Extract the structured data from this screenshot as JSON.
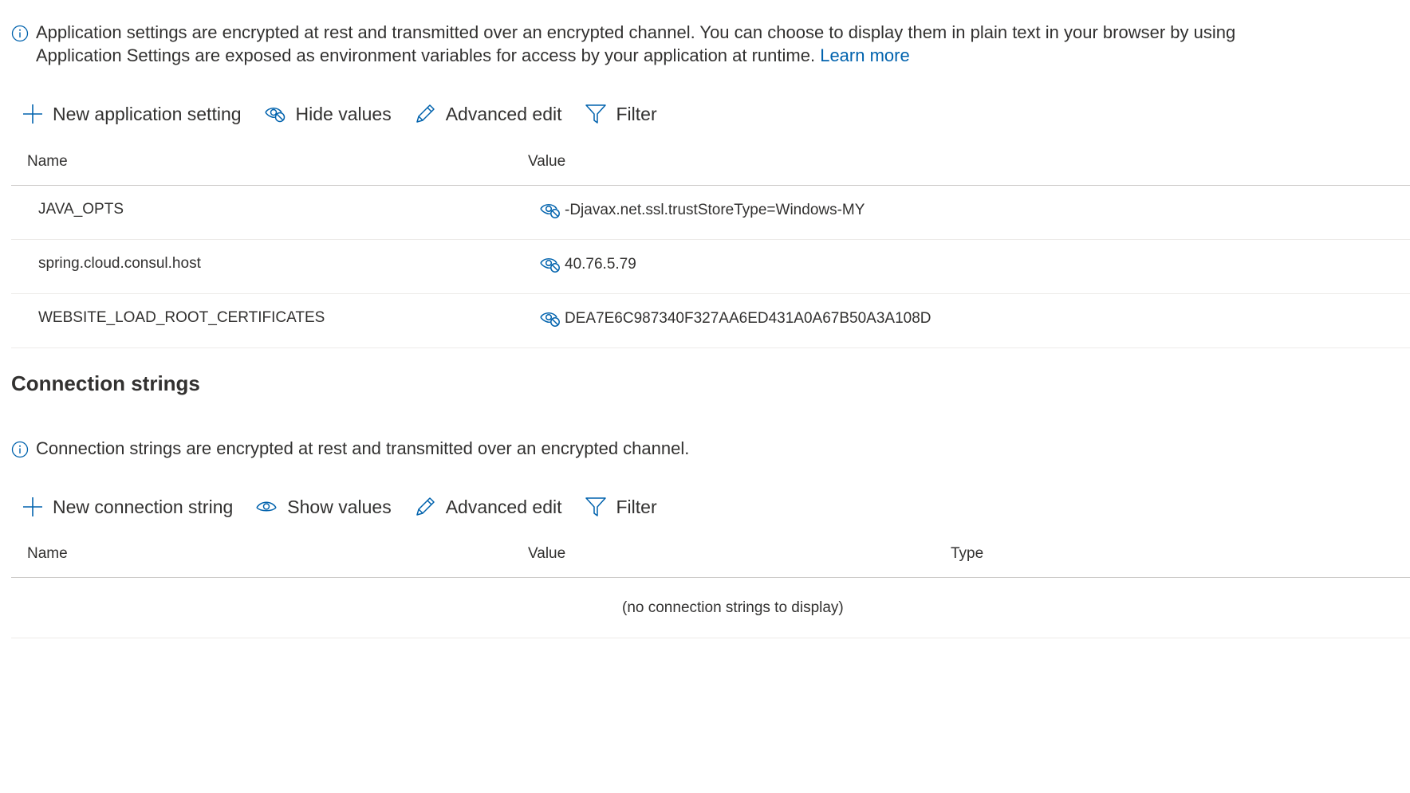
{
  "app_settings": {
    "info_line1": "Application settings are encrypted at rest and transmitted over an encrypted channel. You can choose to display them in plain text in your browser by using",
    "info_line2": "Application Settings are exposed as environment variables for access by your application at runtime.",
    "learn_more": "Learn more",
    "toolbar": {
      "new_label": "New application setting",
      "toggle_values_label": "Hide values",
      "advanced_edit_label": "Advanced edit",
      "filter_label": "Filter"
    },
    "columns": {
      "name": "Name",
      "value": "Value"
    },
    "rows": [
      {
        "name": "JAVA_OPTS",
        "value": "-Djavax.net.ssl.trustStoreType=Windows-MY"
      },
      {
        "name": "spring.cloud.consul.host",
        "value": "40.76.5.79"
      },
      {
        "name": "WEBSITE_LOAD_ROOT_CERTIFICATES",
        "value": "DEA7E6C987340F327AA6ED431A0A67B50A3A108D"
      }
    ]
  },
  "connection_strings": {
    "title": "Connection strings",
    "info": "Connection strings are encrypted at rest and transmitted over an encrypted channel.",
    "toolbar": {
      "new_label": "New connection string",
      "toggle_values_label": "Show values",
      "advanced_edit_label": "Advanced edit",
      "filter_label": "Filter"
    },
    "columns": {
      "name": "Name",
      "value": "Value",
      "type": "Type"
    },
    "empty_text": "(no connection strings to display)"
  },
  "colors": {
    "accent": "#0062ad",
    "text": "#323130",
    "divider": "#c8c6c4"
  }
}
